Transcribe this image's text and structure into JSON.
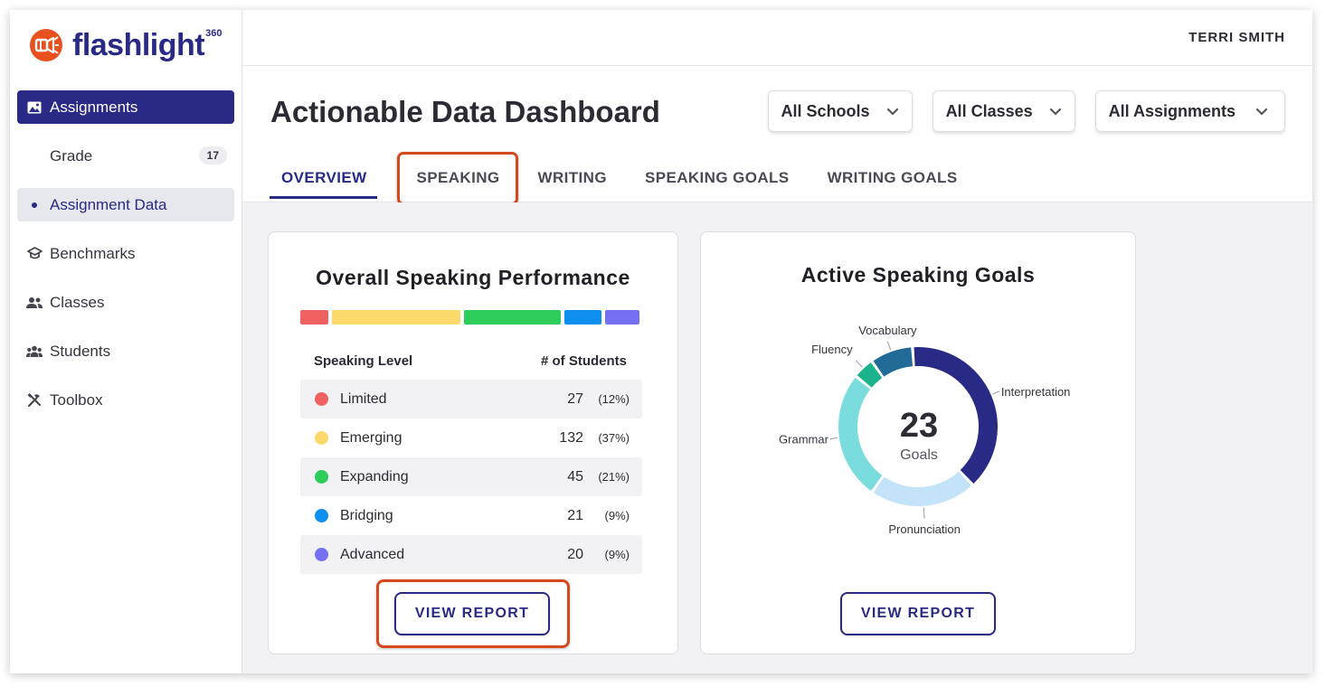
{
  "brand": {
    "name": "flashlight",
    "superscript": "360",
    "color": "#e8501e"
  },
  "user": {
    "name": "TERRI SMITH"
  },
  "sidebar": {
    "items": [
      {
        "label": "Assignments",
        "icon": "image-icon",
        "state": "active"
      },
      {
        "label": "Grade",
        "badge": "17",
        "state": "sub"
      },
      {
        "label": "Assignment Data",
        "state": "selected"
      },
      {
        "label": "Benchmarks",
        "icon": "graduation-cap-icon"
      },
      {
        "label": "Classes",
        "icon": "users-icon"
      },
      {
        "label": "Students",
        "icon": "group-icon"
      },
      {
        "label": "Toolbox",
        "icon": "tools-icon"
      }
    ]
  },
  "header": {
    "title": "Actionable Data Dashboard",
    "filters": [
      "All Schools",
      "All Classes",
      "All Assignments"
    ],
    "tabs": [
      "OVERVIEW",
      "SPEAKING",
      "WRITING",
      "SPEAKING GOALS",
      "WRITING GOALS"
    ],
    "active_tab": "OVERVIEW"
  },
  "performance": {
    "title": "Overall Speaking Performance",
    "col_level": "Speaking Level",
    "col_students": "# of Students",
    "rows": [
      {
        "level": "Limited",
        "count": "27",
        "pct": "(12%)",
        "color": "#f06262"
      },
      {
        "level": "Emerging",
        "count": "132",
        "pct": "(37%)",
        "color": "#fbd96a"
      },
      {
        "level": "Expanding",
        "count": "45",
        "pct": "(21%)",
        "color": "#2ecc5b"
      },
      {
        "level": "Bridging",
        "count": "21",
        "pct": "(9%)",
        "color": "#0d8ff0"
      },
      {
        "level": "Advanced",
        "count": "20",
        "pct": "(9%)",
        "color": "#7570f2"
      }
    ],
    "button": "VIEW REPORT"
  },
  "goals": {
    "title": "Active Speaking Goals",
    "total": "23",
    "total_label": "Goals",
    "button": "VIEW REPORT"
  },
  "chart_data": {
    "type": "pie",
    "title": "Active Speaking Goals",
    "slices": [
      {
        "label": "Interpretation",
        "value": 9,
        "color": "#292986"
      },
      {
        "label": "Pronunciation",
        "value": 5,
        "color": "#c3e3f8"
      },
      {
        "label": "Grammar",
        "value": 6,
        "color": "#7adcdc"
      },
      {
        "label": "Fluency",
        "value": 1,
        "color": "#1ab38c"
      },
      {
        "label": "Vocabulary",
        "value": 2,
        "color": "#226a97"
      }
    ]
  }
}
